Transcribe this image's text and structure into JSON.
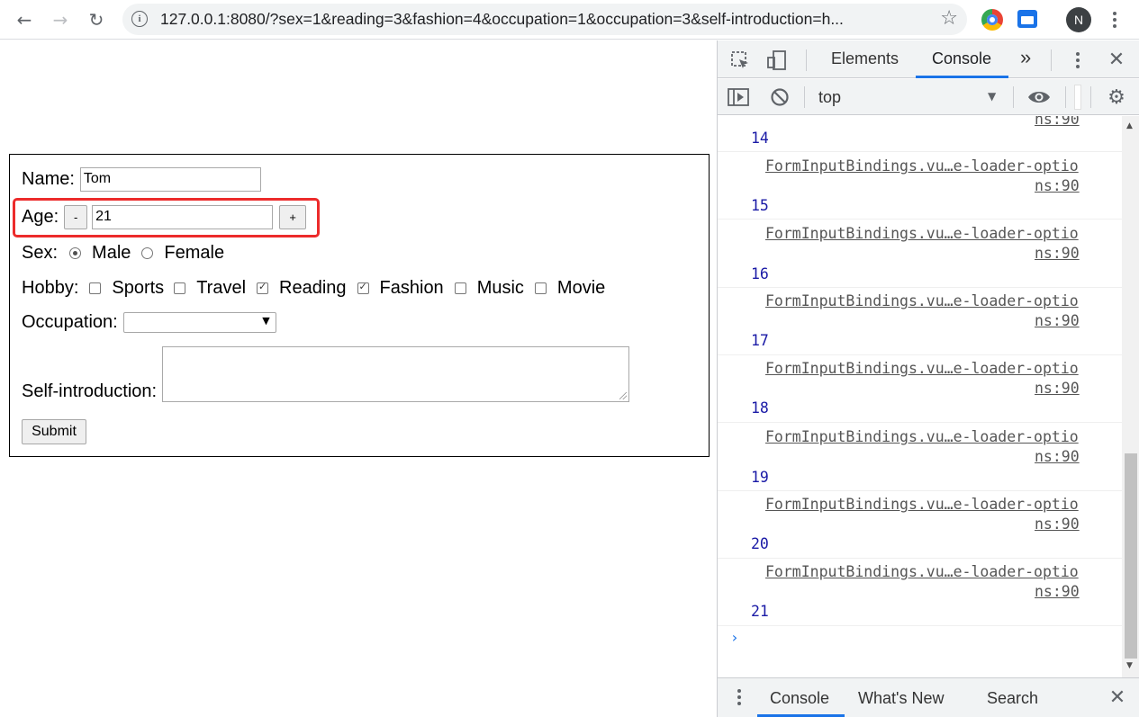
{
  "browser": {
    "url": "127.0.0.1:8080/?sex=1&reading=3&fashion=4&occupation=1&occupation=3&self-introduction=h...",
    "profile_initial": "N"
  },
  "form": {
    "name_label": "Name:",
    "name_value": "Tom",
    "age_label": "Age:",
    "age_minus": "-",
    "age_value": "21",
    "age_plus": "+",
    "sex_label": "Sex:",
    "sex_options": [
      "Male",
      "Female"
    ],
    "sex_selected": "Male",
    "hobby_label": "Hobby:",
    "hobbies": [
      {
        "label": "Sports",
        "checked": false
      },
      {
        "label": "Travel",
        "checked": false
      },
      {
        "label": "Reading",
        "checked": true
      },
      {
        "label": "Fashion",
        "checked": true
      },
      {
        "label": "Music",
        "checked": false
      },
      {
        "label": "Movie",
        "checked": false
      }
    ],
    "occupation_label": "Occupation:",
    "occupation_value": "",
    "selfintro_label": "Self-introduction:",
    "selfintro_value": "",
    "submit_label": "Submit",
    "highlight_color": "#ec2b2b"
  },
  "devtools": {
    "tabs": [
      "Elements",
      "Console"
    ],
    "more_tabs": "»",
    "active_tab": "Console",
    "context": "top",
    "log_top_partial": "ns:90",
    "log_entries": [
      {
        "value": "14"
      },
      {
        "source": "FormInputBindings.vu…e-loader-optio",
        "source_cont": "ns:90",
        "value": "15"
      },
      {
        "source": "FormInputBindings.vu…e-loader-optio",
        "source_cont": "ns:90",
        "value": "16"
      },
      {
        "source": "FormInputBindings.vu…e-loader-optio",
        "source_cont": "ns:90",
        "value": "17"
      },
      {
        "source": "FormInputBindings.vu…e-loader-optio",
        "source_cont": "ns:90",
        "value": "18"
      },
      {
        "source": "FormInputBindings.vu…e-loader-optio",
        "source_cont": "ns:90",
        "value": "19"
      },
      {
        "source": "FormInputBindings.vu…e-loader-optio",
        "source_cont": "ns:90",
        "value": "20"
      },
      {
        "source": "FormInputBindings.vu…e-loader-optio",
        "source_cont": "ns:90",
        "value": "21"
      }
    ],
    "prompt": "›",
    "drawer_tabs": [
      "Console",
      "What's New",
      "Search"
    ],
    "accent_color": "#1a73e8",
    "log_number_color": "#1a1aa6"
  }
}
